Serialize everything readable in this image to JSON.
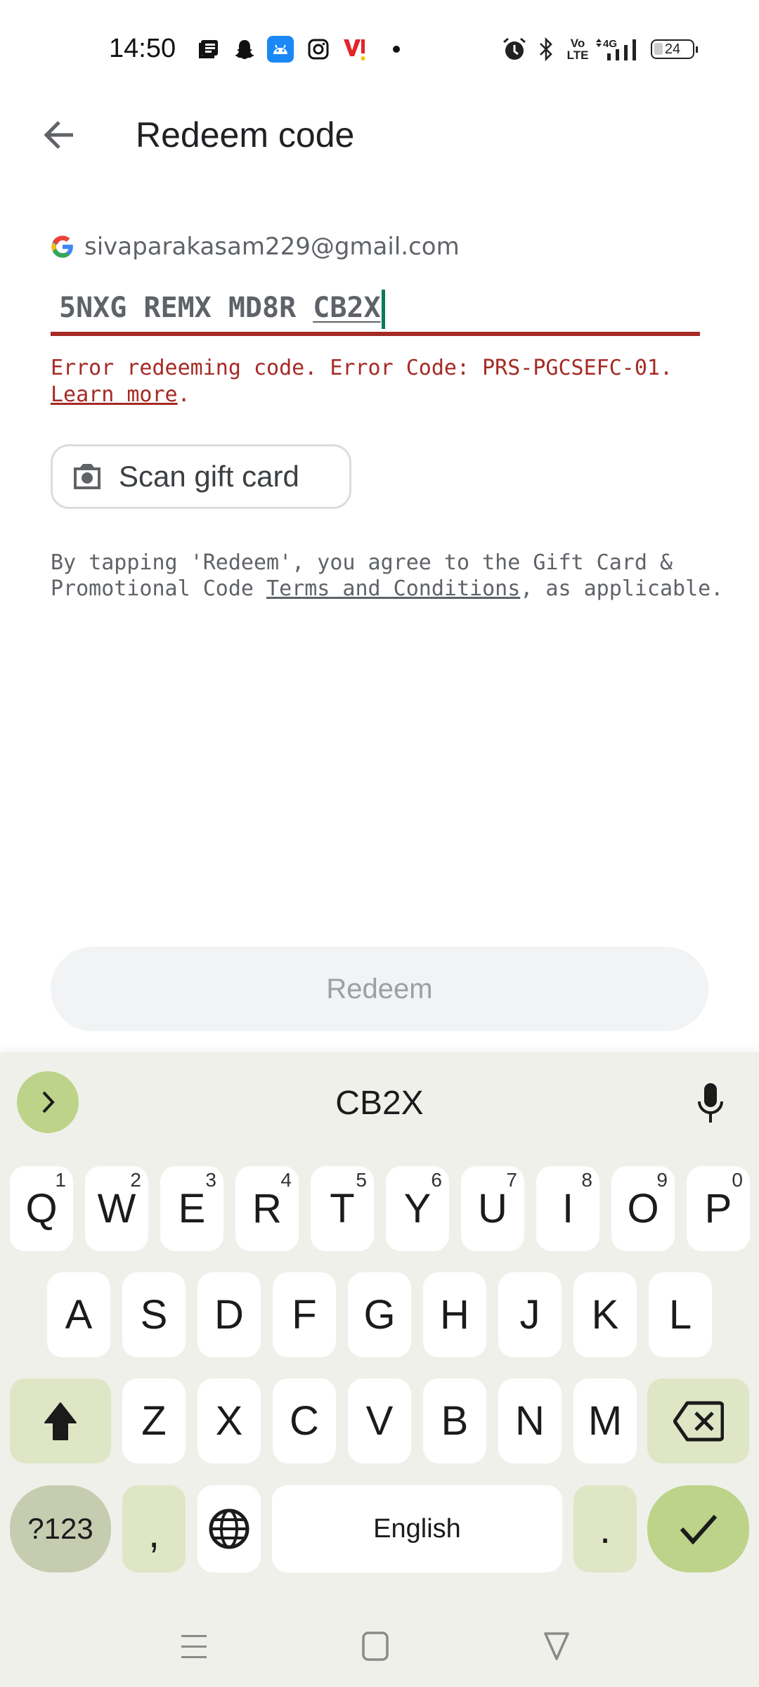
{
  "status_bar": {
    "time": "14:50",
    "left_icons": [
      "news-icon",
      "snapchat-icon",
      "android-app-icon",
      "instagram-icon",
      "vi-carrier-icon",
      "more-notifications-dot"
    ],
    "right_icons": [
      "alarm-icon",
      "bluetooth-icon",
      "volte-icon",
      "4g-signal-icon",
      "battery-icon"
    ],
    "network_label": "4G",
    "volte_label_top": "Vo",
    "volte_label_bottom": "LTE",
    "battery_level": "24"
  },
  "header": {
    "title": "Redeem code",
    "back_icon": "arrow-back-icon"
  },
  "account": {
    "email": "sivaparakasam229@gmail.com"
  },
  "code_input": {
    "value_prefix": "5NXG REMX MD8R ",
    "value_composing": "CB2X",
    "error_color": "#a52a25"
  },
  "error": {
    "message": "Error redeeming code. Error Code: PRS-PGCSEFC-01. ",
    "link": "Learn more",
    "suffix": "."
  },
  "scan_button": {
    "label": "Scan gift card",
    "icon": "camera-icon"
  },
  "terms": {
    "prefix": "By tapping 'Redeem', you agree to the Gift Card & Promotional Code ",
    "link": "Terms and Conditions",
    "suffix": ", as applicable."
  },
  "redeem_button": {
    "label": "Redeem",
    "enabled": false
  },
  "keyboard": {
    "suggestion": "CB2X",
    "row1": [
      {
        "key": "Q",
        "hint": "1"
      },
      {
        "key": "W",
        "hint": "2"
      },
      {
        "key": "E",
        "hint": "3"
      },
      {
        "key": "R",
        "hint": "4"
      },
      {
        "key": "T",
        "hint": "5"
      },
      {
        "key": "Y",
        "hint": "6"
      },
      {
        "key": "U",
        "hint": "7"
      },
      {
        "key": "I",
        "hint": "8"
      },
      {
        "key": "O",
        "hint": "9"
      },
      {
        "key": "P",
        "hint": "0"
      }
    ],
    "row2": [
      "A",
      "S",
      "D",
      "F",
      "G",
      "H",
      "J",
      "K",
      "L"
    ],
    "row3": [
      "Z",
      "X",
      "C",
      "V",
      "B",
      "N",
      "M"
    ],
    "symbols_label": "?123",
    "comma_label": ",",
    "space_label": "English",
    "period_label": ".",
    "accent_color": "#bcd389"
  },
  "nav_bar": {
    "buttons": [
      "recents-icon",
      "home-icon",
      "back-triangle-icon"
    ]
  }
}
